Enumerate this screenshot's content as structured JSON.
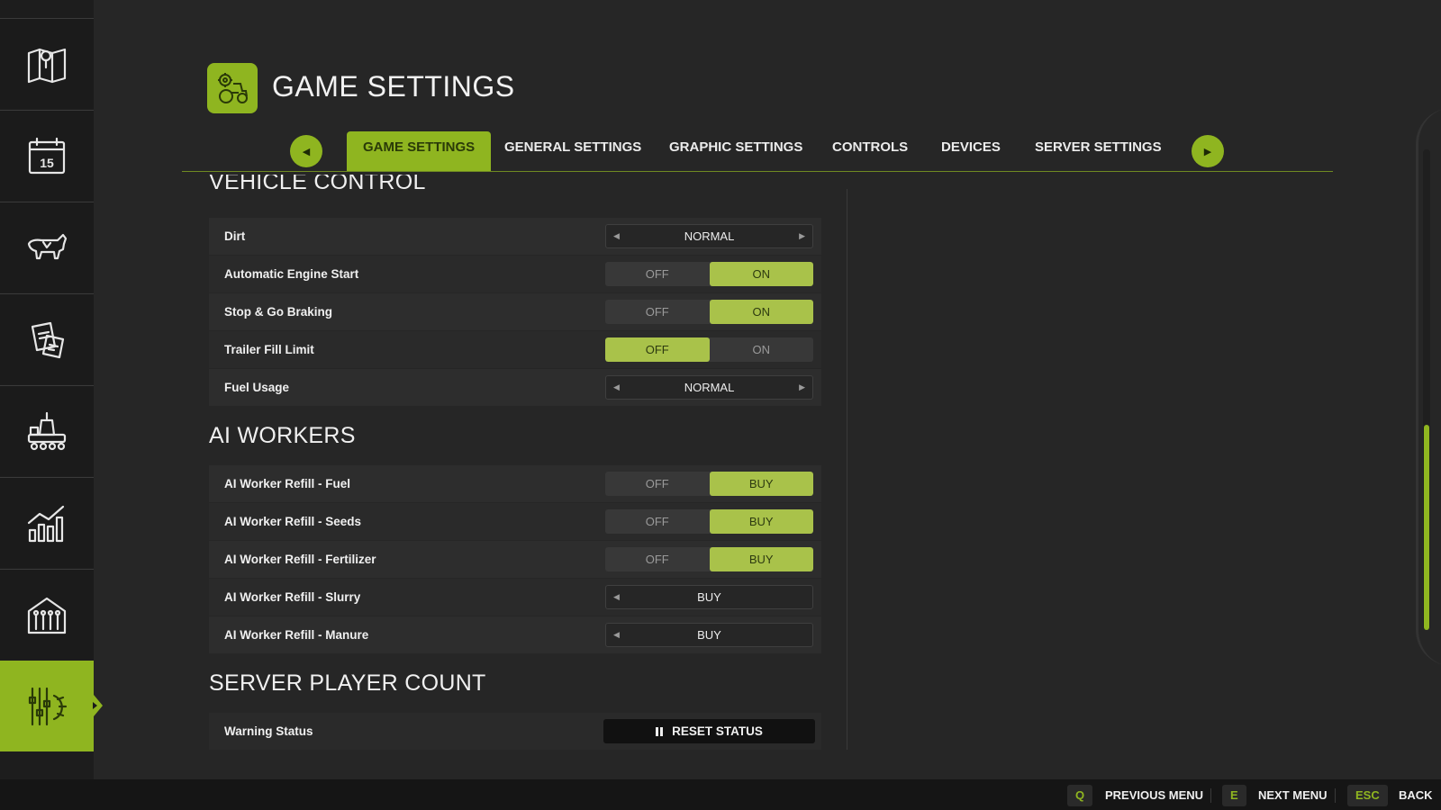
{
  "header": {
    "title": "GAME SETTINGS"
  },
  "tabs": {
    "prev_icon": "chevron-left-icon",
    "next_icon": "chevron-right-icon",
    "items": [
      {
        "label": "GAME SETTINGS",
        "active": true
      },
      {
        "label": "GENERAL SETTINGS"
      },
      {
        "label": "GRAPHIC SETTINGS"
      },
      {
        "label": "CONTROLS"
      },
      {
        "label": "DEVICES"
      },
      {
        "label": "SERVER SETTINGS"
      }
    ]
  },
  "sidebar": {
    "items": [
      {
        "icon": "map-icon"
      },
      {
        "icon": "calendar-icon",
        "day": "15"
      },
      {
        "icon": "cow-icon"
      },
      {
        "icon": "contracts-icon"
      },
      {
        "icon": "production-icon"
      },
      {
        "icon": "statistics-icon"
      },
      {
        "icon": "barn-icon"
      },
      {
        "icon": "settings-sliders-icon",
        "active": true
      }
    ]
  },
  "sections": {
    "vehicle_control": {
      "title": "VEHICLE CONTROL",
      "rows": [
        {
          "label": "Dirt",
          "type": "selector",
          "value": "NORMAL"
        },
        {
          "label": "Automatic Engine Start",
          "type": "toggle",
          "off": "OFF",
          "on": "ON",
          "selected": "on"
        },
        {
          "label": "Stop & Go Braking",
          "type": "toggle",
          "off": "OFF",
          "on": "ON",
          "selected": "on"
        },
        {
          "label": "Trailer Fill Limit",
          "type": "toggle",
          "off": "OFF",
          "on": "ON",
          "selected": "off"
        },
        {
          "label": "Fuel Usage",
          "type": "selector",
          "value": "NORMAL"
        }
      ]
    },
    "ai_workers": {
      "title": "AI WORKERS",
      "rows": [
        {
          "label": "AI Worker Refill - Fuel",
          "type": "toggle",
          "off": "OFF",
          "on": "BUY",
          "selected": "on"
        },
        {
          "label": "AI Worker Refill - Seeds",
          "type": "toggle",
          "off": "OFF",
          "on": "BUY",
          "selected": "on"
        },
        {
          "label": "AI Worker Refill - Fertilizer",
          "type": "toggle",
          "off": "OFF",
          "on": "BUY",
          "selected": "on"
        },
        {
          "label": "AI Worker Refill - Slurry",
          "type": "selector",
          "value": "BUY"
        },
        {
          "label": "AI Worker Refill - Manure",
          "type": "selector",
          "value": "BUY"
        }
      ]
    },
    "server_player_count": {
      "title": "SERVER PLAYER COUNT",
      "rows": [
        {
          "label": "Warning Status",
          "type": "button",
          "value": "RESET STATUS"
        }
      ]
    }
  },
  "footer": {
    "prev": {
      "key": "Q",
      "label": "PREVIOUS MENU"
    },
    "next": {
      "key": "E",
      "label": "NEXT MENU"
    },
    "back": {
      "key": "ESC",
      "label": "BACK"
    }
  },
  "colors": {
    "accent": "#8fb520",
    "toggle_on": "#a9c24a",
    "background": "#262626"
  }
}
